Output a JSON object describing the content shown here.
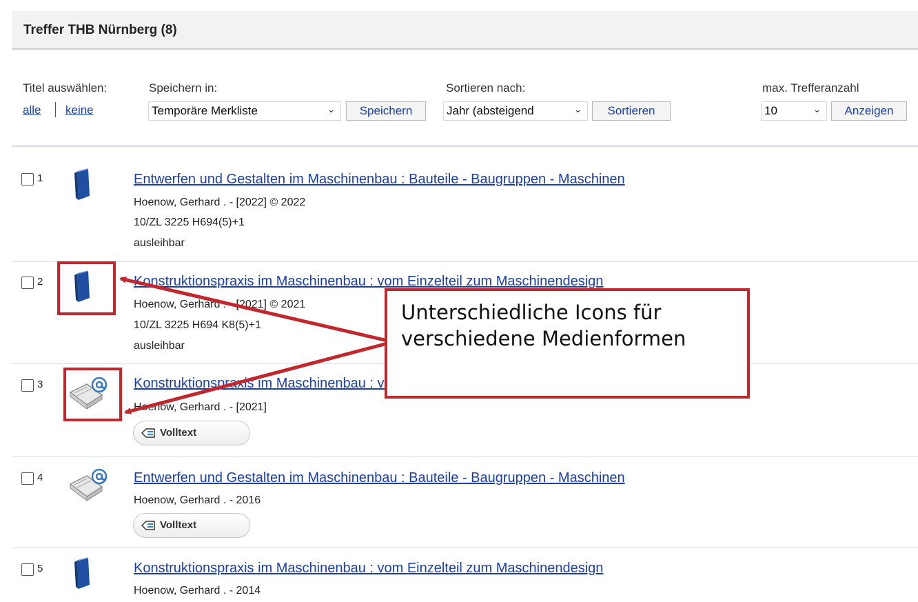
{
  "header": {
    "title": "Treffer THB Nürnberg (8)"
  },
  "toolbar": {
    "select_label": "Titel auswählen:",
    "select_all": "alle",
    "select_none": "keine",
    "save_label": "Speichern in:",
    "save_target": "Temporäre Merkliste",
    "save_button": "Speichern",
    "sort_label": "Sortieren nach:",
    "sort_value": "Jahr (absteigend",
    "sort_button": "Sortieren",
    "max_label": "max. Trefferanzahl",
    "max_value": "10",
    "max_button": "Anzeigen"
  },
  "results": [
    {
      "num": "1",
      "media": "book-icon",
      "title": "Entwerfen und Gestalten im Maschinenbau : Bauteile - Baugruppen - Maschinen",
      "author": "Hoenow, Gerhard . - [2022] © 2022",
      "signature": "10/ZL 3225 H694(5)+1",
      "status": "ausleihbar"
    },
    {
      "num": "2",
      "media": "book-icon",
      "title": "Konstruktionspraxis im Maschinenbau : vom Einzelteil zum Maschinendesign",
      "author": "Hoenow, Gerhard . - [2021] © 2021",
      "signature": "10/ZL 3225 H694 K8(5)+1",
      "status": "ausleihbar"
    },
    {
      "num": "3",
      "media": "ebook-icon",
      "title": "Konstruktionspraxis im Maschinenbau : vom Einzelteil zum Maschinendesign",
      "author": "Hoenow, Gerhard . - [2021]",
      "fulltext": "Volltext"
    },
    {
      "num": "4",
      "media": "ebook-icon",
      "title": "Entwerfen und Gestalten im Maschinenbau : Bauteile - Baugruppen - Maschinen",
      "author": "Hoenow, Gerhard . - 2016",
      "fulltext": "Volltext"
    },
    {
      "num": "5",
      "media": "book-icon",
      "title": "Konstruktionspraxis im Maschinenbau : vom Einzelteil zum Maschinendesign",
      "author": "Hoenow, Gerhard . - 2014"
    }
  ],
  "annotation": {
    "text": "Unterschiedliche Icons für verschiedene Medienformen",
    "color": "#c1272d"
  },
  "colors": {
    "link": "#1a3fa8",
    "book": "#1f4fa0",
    "header_bg": "#f2f2f2"
  }
}
